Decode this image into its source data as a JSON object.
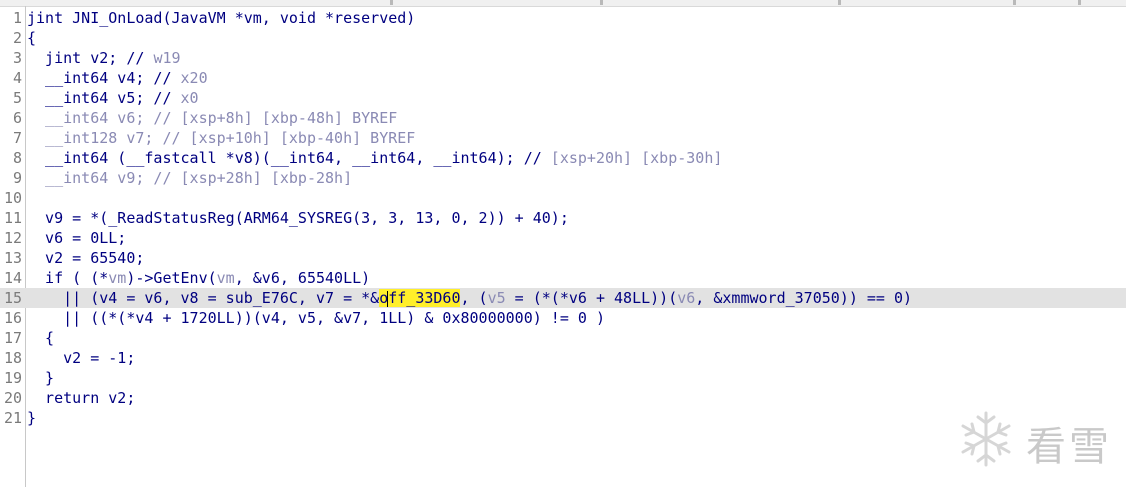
{
  "editor": {
    "lines": [
      {
        "number": "1",
        "segments": [
          {
            "text": "jint JNI_OnLoad(JavaVM *vm, void *reserved)",
            "style": "n"
          }
        ]
      },
      {
        "number": "2",
        "segments": [
          {
            "text": "{",
            "style": "n"
          }
        ]
      },
      {
        "number": "3",
        "segments": [
          {
            "text": "  jint v2; // ",
            "style": "n"
          },
          {
            "text": "w19",
            "style": "g"
          }
        ]
      },
      {
        "number": "4",
        "segments": [
          {
            "text": "  __int64 v4; // ",
            "style": "n"
          },
          {
            "text": "x20",
            "style": "g"
          }
        ]
      },
      {
        "number": "5",
        "segments": [
          {
            "text": "  __int64 v5; // ",
            "style": "n"
          },
          {
            "text": "x0",
            "style": "g"
          }
        ]
      },
      {
        "number": "6",
        "segments": [
          {
            "text": "  __int64 v6; // [xsp+8h] [xbp-48h] BYREF",
            "style": "g"
          }
        ]
      },
      {
        "number": "7",
        "segments": [
          {
            "text": "  __int128 v7; // [xsp+10h] [xbp-40h] BYREF",
            "style": "g"
          }
        ]
      },
      {
        "number": "8",
        "segments": [
          {
            "text": "  __int64 (__fastcall *v8)(__int64, __int64, __int64); // ",
            "style": "n"
          },
          {
            "text": "[xsp+20h] [xbp-30h]",
            "style": "g"
          }
        ]
      },
      {
        "number": "9",
        "segments": [
          {
            "text": "  __int64 v9; // [xsp+28h] [xbp-28h]",
            "style": "g"
          }
        ]
      },
      {
        "number": "10",
        "segments": [
          {
            "text": "",
            "style": "n"
          }
        ]
      },
      {
        "number": "11",
        "segments": [
          {
            "text": "  v9 = *(_ReadStatusReg(ARM64_SYSREG(3, 3, 13, 0, 2)) + 40);",
            "style": "n"
          }
        ]
      },
      {
        "number": "12",
        "segments": [
          {
            "text": "  v6 = 0LL;",
            "style": "n"
          }
        ]
      },
      {
        "number": "13",
        "segments": [
          {
            "text": "  v2 = 65540;",
            "style": "n"
          }
        ]
      },
      {
        "number": "14",
        "segments": [
          {
            "text": "  if ( (*",
            "style": "n"
          },
          {
            "text": "vm",
            "style": "g"
          },
          {
            "text": ")->GetEnv(",
            "style": "n"
          },
          {
            "text": "vm",
            "style": "g"
          },
          {
            "text": ", &v6, 65540LL)",
            "style": "n"
          }
        ]
      },
      {
        "number": "15",
        "highlight": true,
        "segments": [
          {
            "text": "    || (v4 = v6, v8 = sub_E76C, v7 = *&",
            "style": "n"
          },
          {
            "text": "o",
            "style": "ny"
          },
          {
            "caret": true
          },
          {
            "text": "ff_33D60",
            "style": "ny"
          },
          {
            "text": ", (",
            "style": "n"
          },
          {
            "text": "v5",
            "style": "g"
          },
          {
            "text": " = (*(*v6 + 48LL))(",
            "style": "n"
          },
          {
            "text": "v6",
            "style": "g"
          },
          {
            "text": ", &xmmword_37050)) == 0)",
            "style": "n"
          }
        ]
      },
      {
        "number": "16",
        "segments": [
          {
            "text": "    || ((*(*v4 + 1720LL))(v4, v5, &v7, 1LL) & 0x80000000) != 0 )",
            "style": "n"
          }
        ]
      },
      {
        "number": "17",
        "segments": [
          {
            "text": "  {",
            "style": "n"
          }
        ]
      },
      {
        "number": "18",
        "segments": [
          {
            "text": "    v2 = -1;",
            "style": "n"
          }
        ]
      },
      {
        "number": "19",
        "segments": [
          {
            "text": "  }",
            "style": "n"
          }
        ]
      },
      {
        "number": "20",
        "segments": [
          {
            "text": "  return v2;",
            "style": "n"
          }
        ]
      },
      {
        "number": "21",
        "segments": [
          {
            "text": "}",
            "style": "n"
          }
        ]
      }
    ]
  },
  "watermark": {
    "text": "看雪",
    "icon": "snowflake-icon"
  },
  "colors": {
    "keyword_text": "#000080",
    "comment_text": "#8a8ab4",
    "highlight_bg": "#ffef2a",
    "line_highlight": "#e2e2e2"
  }
}
